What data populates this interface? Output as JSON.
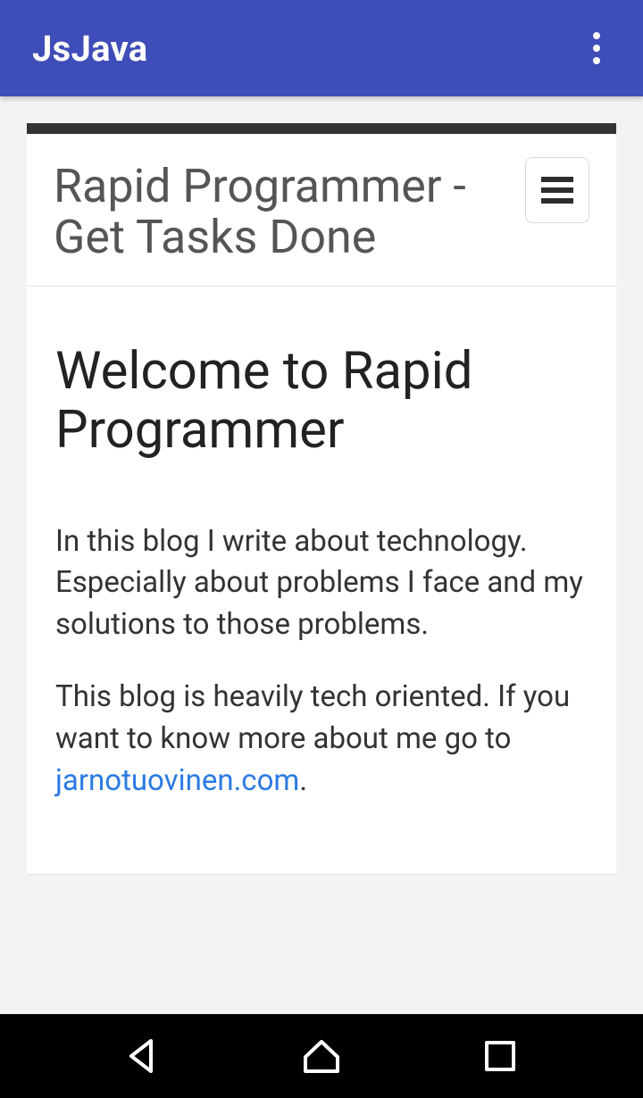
{
  "appBar": {
    "title": "JsJava"
  },
  "page": {
    "siteTitle": "Rapid Programmer - Get Tasks Done",
    "heading": "Welcome to Rapid Programmer",
    "paragraph1": "In this blog I write about technology. Especially about problems I face and my solutions to those problems.",
    "paragraph2a": "This blog is heavily tech oriented. If you want to know more about me go to ",
    "linkText": "jarnotuovinen.com",
    "paragraph2b": "."
  },
  "colors": {
    "appBar": "#3f4db8",
    "link": "#2a7ae2"
  }
}
